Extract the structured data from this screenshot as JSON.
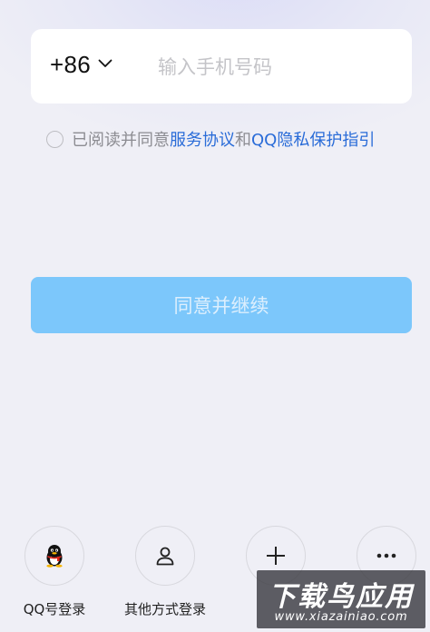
{
  "phone": {
    "country_code": "+86",
    "placeholder": "输入手机号码",
    "value": ""
  },
  "agreement": {
    "checked": false,
    "prefix": "已阅读并同意",
    "service_link": "服务协议",
    "and": "和",
    "privacy_link": "QQ隐私保护指引"
  },
  "continue_button": {
    "label": "同意并继续",
    "color": "#7cc7fb"
  },
  "login_options": [
    {
      "icon": "qq-penguin-icon",
      "label": "QQ号登录"
    },
    {
      "icon": "person-icon",
      "label": "其他方式登录"
    },
    {
      "icon": "plus-icon",
      "label": ""
    },
    {
      "icon": "more-dots-icon",
      "label": ""
    }
  ],
  "watermark": {
    "title": "下载鸟应用",
    "url": "www.xiazainiao.com"
  },
  "colors": {
    "link": "#2a6cd8",
    "background": "#efeff6"
  }
}
